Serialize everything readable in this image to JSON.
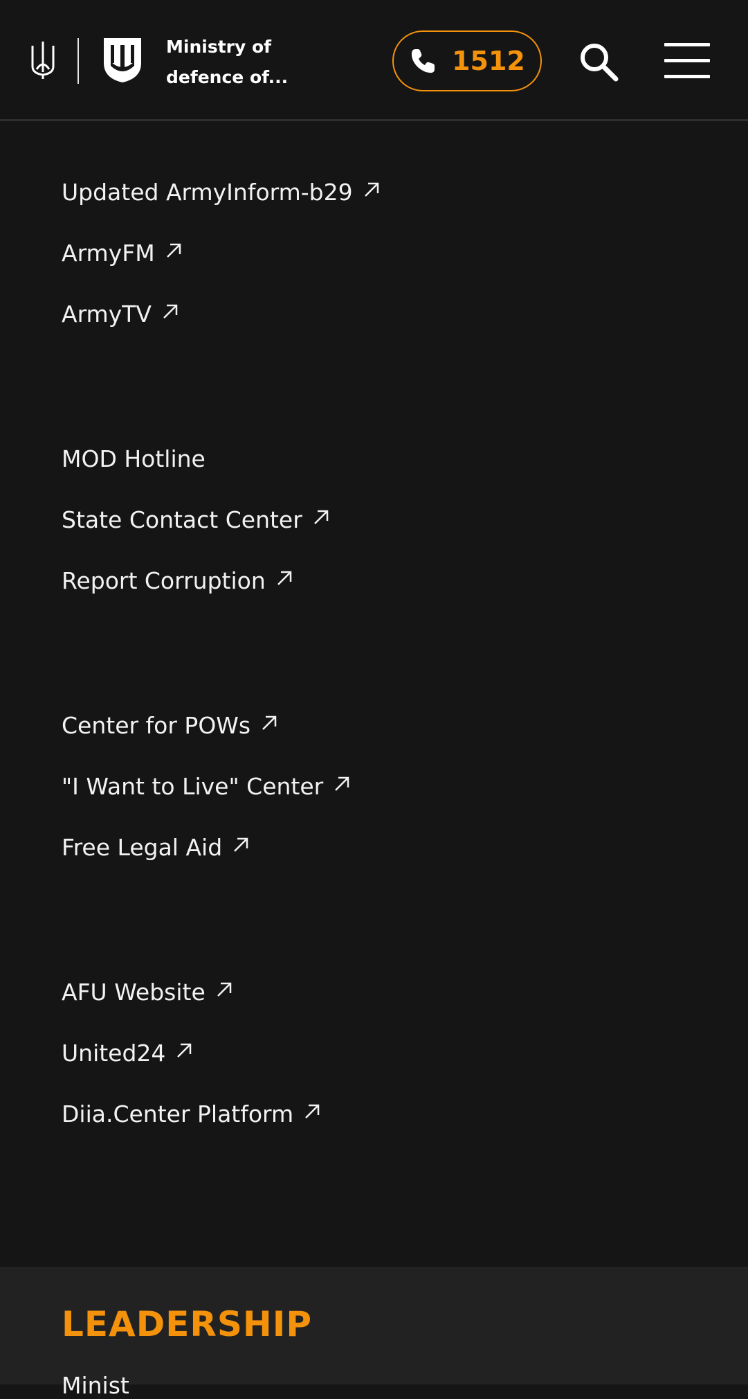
{
  "header": {
    "brand_line1": "Ministry of",
    "brand_line2": "defence of...",
    "phone": "1512",
    "icons": {
      "trident": "trident-icon",
      "shield": "shield-trident-icon",
      "phone": "phone-icon",
      "search": "search-icon",
      "menu": "hamburger-menu-icon"
    },
    "accent_color": "#f4920c"
  },
  "link_groups": [
    [
      {
        "label": "Updated ArmyInform-b29",
        "external": true
      },
      {
        "label": "ArmyFM",
        "external": true
      },
      {
        "label": "ArmyTV",
        "external": true
      }
    ],
    [
      {
        "label": "MOD Hotline",
        "external": false
      },
      {
        "label": "State Contact Center",
        "external": true
      },
      {
        "label": "Report Corruption",
        "external": true
      }
    ],
    [
      {
        "label": "Center for POWs",
        "external": true
      },
      {
        "label": "\"I Want to Live\" Center",
        "external": true
      },
      {
        "label": "Free Legal Aid",
        "external": true
      }
    ],
    [
      {
        "label": "AFU Website",
        "external": true
      },
      {
        "label": "United24",
        "external": true
      },
      {
        "label": "Diia.Center Platform",
        "external": true
      }
    ]
  ],
  "leadership": {
    "title": "LEADERSHIP",
    "peek": "Minist"
  }
}
